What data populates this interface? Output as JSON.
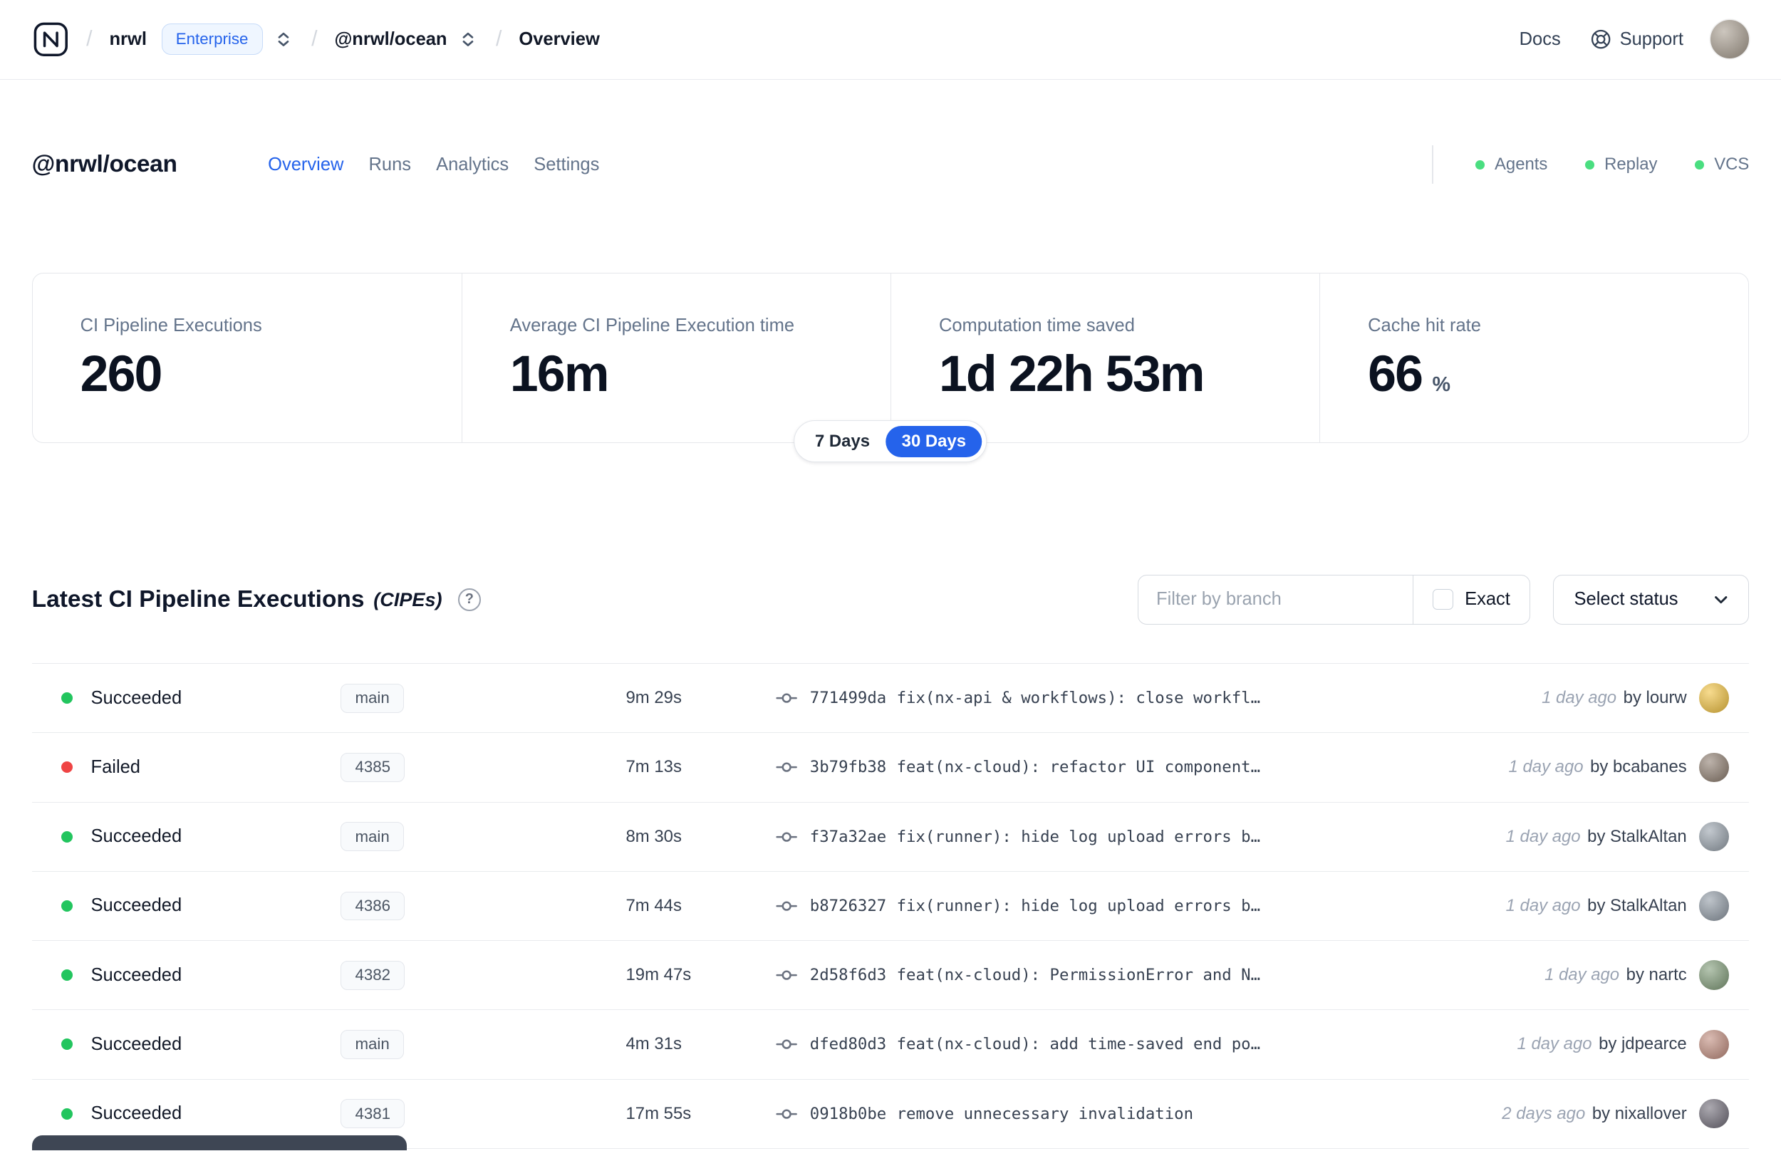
{
  "colors": {
    "accent": "#2563eb",
    "success": "#22c55e",
    "failure": "#ef4444",
    "status_dot": "#4ade80"
  },
  "navbar": {
    "separator": "/",
    "org": "nrwl",
    "org_badge": "Enterprise",
    "workspace": "@nrwl/ocean",
    "page": "Overview",
    "docs_label": "Docs",
    "support_label": "Support",
    "avatar_style": "--av:#a89d8f"
  },
  "header": {
    "title": "@nrwl/ocean",
    "active_tab": "Overview",
    "tabs": [
      {
        "label": "Overview"
      },
      {
        "label": "Runs"
      },
      {
        "label": "Analytics"
      },
      {
        "label": "Settings"
      }
    ],
    "statuses": [
      {
        "label": "Agents"
      },
      {
        "label": "Replay"
      },
      {
        "label": "VCS"
      }
    ]
  },
  "stats": {
    "cards": [
      {
        "label": "CI Pipeline Executions",
        "value": "260"
      },
      {
        "label": "Average CI Pipeline Execution time",
        "value": "16m"
      },
      {
        "label": "Computation time saved",
        "value": "1d 22h 53m"
      },
      {
        "label": "Cache hit rate",
        "value": "66",
        "unit": "%"
      }
    ],
    "toggle": {
      "options": [
        "7 Days",
        "30 Days"
      ],
      "selected": "30 Days"
    }
  },
  "cipe": {
    "title": "Latest CI Pipeline Executions",
    "suffix": "(CIPEs)",
    "help_icon": "?",
    "filter_placeholder": "Filter by branch",
    "exact_label": "Exact",
    "select_status_label": "Select status",
    "rows": [
      {
        "status": "Succeeded",
        "state": "succeeded",
        "branch": "main",
        "duration": "9m 29s",
        "hash": "771499da",
        "message": "fix(nx-api & workflows): close workfl…",
        "time": "1 day ago",
        "author": "by lourw",
        "avatar_style": "--av:#f2c23e"
      },
      {
        "status": "Failed",
        "state": "failed",
        "branch": "4385",
        "duration": "7m 13s",
        "hash": "3b79fb38",
        "message": "feat(nx-cloud): refactor UI component…",
        "time": "1 day ago",
        "author": "by bcabanes",
        "avatar_style": "--av:#8d7c6e"
      },
      {
        "status": "Succeeded",
        "state": "succeeded",
        "branch": "main",
        "duration": "8m 30s",
        "hash": "f37a32ae",
        "message": "fix(runner): hide log upload errors b…",
        "time": "1 day ago",
        "author": "by StalkAltan",
        "avatar_style": "--av:#97a1ab"
      },
      {
        "status": "Succeeded",
        "state": "succeeded",
        "branch": "4386",
        "duration": "7m 44s",
        "hash": "b8726327",
        "message": "fix(runner): hide log upload errors b…",
        "time": "1 day ago",
        "author": "by StalkAltan",
        "avatar_style": "--av:#8f99a4"
      },
      {
        "status": "Succeeded",
        "state": "succeeded",
        "branch": "4382",
        "duration": "19m 47s",
        "hash": "2d58f6d3",
        "message": "feat(nx-cloud): PermissionError and N…",
        "time": "1 day ago",
        "author": "by nartc",
        "avatar_style": "--av:#7f9b77"
      },
      {
        "status": "Succeeded",
        "state": "succeeded",
        "branch": "main",
        "duration": "4m 31s",
        "hash": "dfed80d3",
        "message": "feat(nx-cloud): add time-saved end po…",
        "time": "1 day ago",
        "author": "by jdpearce",
        "avatar_style": "--av:#c08b7c"
      },
      {
        "status": "Succeeded",
        "state": "succeeded",
        "branch": "4381",
        "duration": "17m 55s",
        "hash": "0918b0be",
        "message": "remove unnecessary invalidation",
        "time": "2 days ago",
        "author": "by nixallover",
        "avatar_style": "--av:#6f6b77"
      }
    ]
  }
}
